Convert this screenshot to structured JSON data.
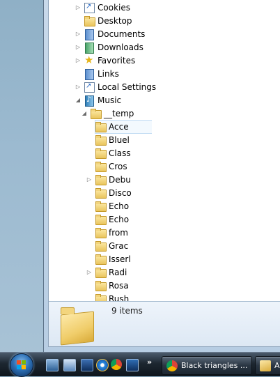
{
  "tree": {
    "items": [
      {
        "label": "Cookies",
        "icon": "shortcut-icon",
        "expander": "collapsed"
      },
      {
        "label": "Desktop",
        "icon": "folder-icon",
        "expander": "none"
      },
      {
        "label": "Documents",
        "icon": "documents-icon",
        "expander": "collapsed"
      },
      {
        "label": "Downloads",
        "icon": "downloads-icon",
        "expander": "collapsed"
      },
      {
        "label": "Favorites",
        "icon": "favorites-icon",
        "expander": "collapsed"
      },
      {
        "label": "Links",
        "icon": "links-icon",
        "expander": "none"
      },
      {
        "label": "Local Settings",
        "icon": "shortcut-icon",
        "expander": "collapsed"
      },
      {
        "label": "Music",
        "icon": "music-icon",
        "expander": "expanded"
      },
      {
        "label": "__temp",
        "icon": "folder-icon",
        "expander": "expanded"
      }
    ],
    "children": [
      {
        "label": "Acce",
        "expander": "none",
        "selected": true
      },
      {
        "label": "Bluel",
        "expander": "none"
      },
      {
        "label": "Class",
        "expander": "none"
      },
      {
        "label": "Cros",
        "expander": "none"
      },
      {
        "label": "Debu",
        "expander": "collapsed"
      },
      {
        "label": "Disco",
        "expander": "none"
      },
      {
        "label": "Echo",
        "expander": "none"
      },
      {
        "label": "Echo",
        "expander": "none"
      },
      {
        "label": "from",
        "expander": "none"
      },
      {
        "label": "Grac",
        "expander": "none"
      },
      {
        "label": "Isserl",
        "expander": "none"
      },
      {
        "label": "Radi",
        "expander": "collapsed"
      },
      {
        "label": "Rosa",
        "expander": "none"
      },
      {
        "label": "Rush",
        "expander": "none"
      }
    ]
  },
  "details": {
    "item_count": "9 items",
    "icon": "folder-icon"
  },
  "taskbar": {
    "start_icon": "windows-start-orb",
    "quick_launch": [
      "show-desktop-icon",
      "switch-windows-icon",
      "computer-icon",
      "internet-explorer-icon",
      "chrome-icon",
      "remote-desktop-icon"
    ],
    "overflow": "»",
    "buttons": [
      {
        "label": "Black triangles ...",
        "icon": "chrome-icon"
      },
      {
        "label": "A",
        "icon": "folder-icon"
      }
    ]
  }
}
